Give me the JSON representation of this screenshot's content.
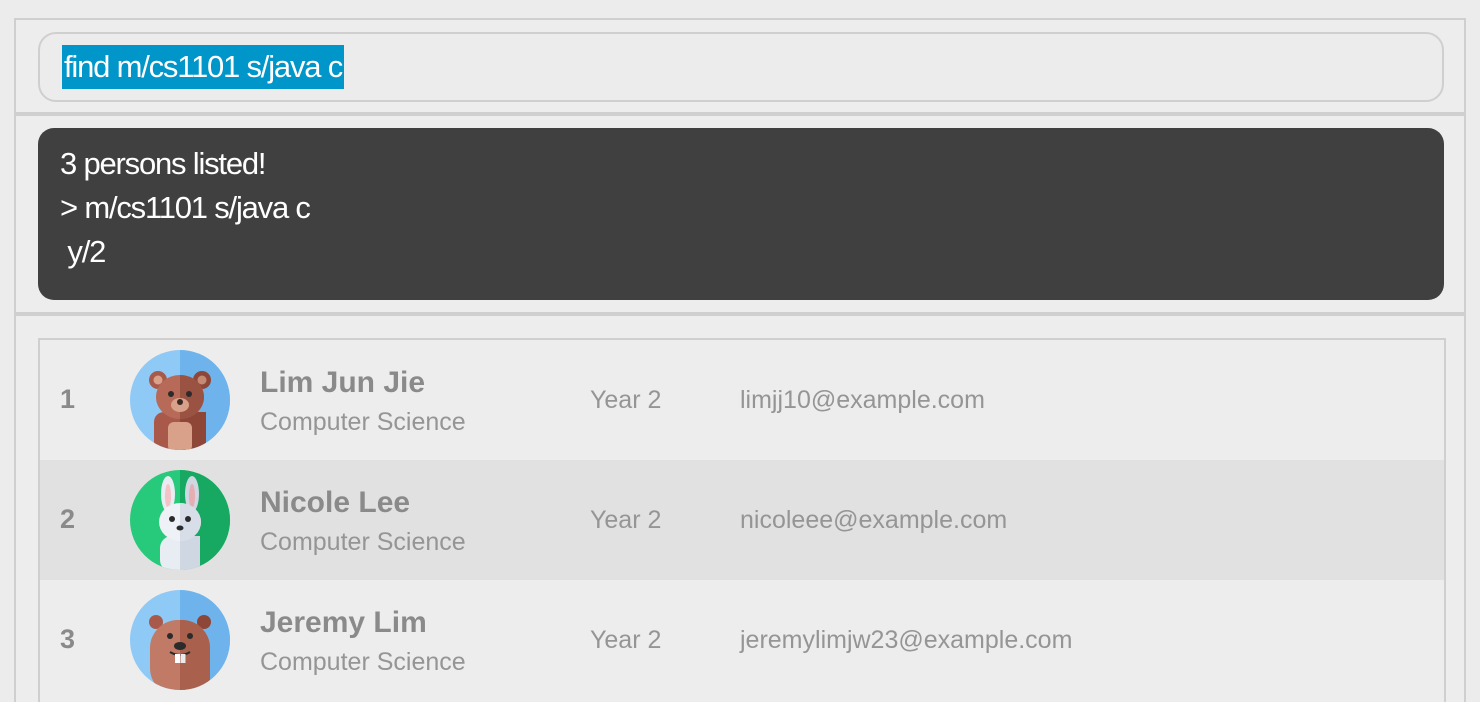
{
  "command_box": {
    "value": "find m/cs1101 s/java c"
  },
  "result_display": {
    "lines": [
      "3 persons listed!",
      "> m/cs1101 s/java c",
      " y/2"
    ]
  },
  "person_list": [
    {
      "index": "1",
      "name": "Lim Jun Jie",
      "major": "Computer Science",
      "year": "Year 2",
      "email": "limjj10@example.com",
      "avatar_icon": "bear-icon"
    },
    {
      "index": "2",
      "name": "Nicole Lee",
      "major": "Computer Science",
      "year": "Year 2",
      "email": "nicoleee@example.com",
      "avatar_icon": "rabbit-icon"
    },
    {
      "index": "3",
      "name": "Jeremy Lim",
      "major": "Computer Science",
      "year": "Year 2",
      "email": "jeremylimjw23@example.com",
      "avatar_icon": "beaver-icon"
    }
  ],
  "colors": {
    "background": "#ececec",
    "selection_highlight": "#0096c9",
    "result_background": "#404040",
    "row_alt": "#e1e1e1"
  }
}
